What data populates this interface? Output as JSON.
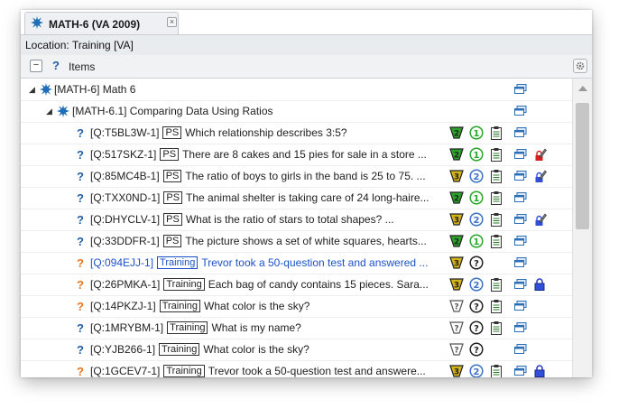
{
  "tab": {
    "title": "MATH-6 (VA 2009)",
    "close": "×"
  },
  "location": "Location: Training [VA]",
  "header": {
    "collapse": "−",
    "label": "Items"
  },
  "tree": {
    "root": {
      "label": "[MATH-6] Math 6"
    },
    "group": {
      "label": "[MATH-6.1] Comparing Data Using Ratios"
    },
    "rows": [
      {
        "id": "[Q:T5BL3W-1]",
        "tag": "PS",
        "text": "Which relationship describes 3:5?",
        "qcolor": "blue",
        "flag": "2",
        "flagcolor": "#2aa52a",
        "circle": "1",
        "circlecolor": "#2aa52a",
        "notes": true,
        "lock": ""
      },
      {
        "id": "[Q:517SKZ-1]",
        "tag": "PS",
        "text": "There are 8 cakes and 15 pies for sale in a store ...",
        "qcolor": "blue",
        "flag": "2",
        "flagcolor": "#2aa52a",
        "circle": "1",
        "circlecolor": "#2aa52a",
        "notes": true,
        "lock": "red"
      },
      {
        "id": "[Q:85MC4B-1]",
        "tag": "PS",
        "text": "The ratio of boys to girls in the band is 25 to 75. ...",
        "qcolor": "blue",
        "flag": "3",
        "flagcolor": "#d4b31a",
        "circle": "2",
        "circlecolor": "#3b73c4",
        "notes": true,
        "lock": "blue"
      },
      {
        "id": "[Q:TXX0ND-1]",
        "tag": "PS",
        "text": "The animal shelter is taking care of 24 long-haire...",
        "qcolor": "blue",
        "flag": "2",
        "flagcolor": "#2aa52a",
        "circle": "1",
        "circlecolor": "#2aa52a",
        "notes": true,
        "lock": ""
      },
      {
        "id": "[Q:DHYCLV-1]",
        "tag": "PS",
        "text": "What is the ratio of stars to total shapes? ...",
        "qcolor": "blue",
        "flag": "3",
        "flagcolor": "#d4b31a",
        "circle": "2",
        "circlecolor": "#3b73c4",
        "notes": true,
        "lock": "blue"
      },
      {
        "id": "[Q:33DDFR-1]",
        "tag": "PS",
        "text": "The picture shows a set of white squares, hearts...",
        "qcolor": "blue",
        "flag": "2",
        "flagcolor": "#2aa52a",
        "circle": "1",
        "circlecolor": "#2aa52a",
        "notes": true,
        "lock": ""
      },
      {
        "id": "[Q:094EJJ-1]",
        "tag": "Training",
        "text": "Trevor took a 50-question test and answered ...",
        "qcolor": "orange",
        "textblue": true,
        "flag": "3",
        "flagcolor": "#d4b31a",
        "circle": "?",
        "circlecolor": "#222",
        "notes": false,
        "lock": ""
      },
      {
        "id": "[Q:26PMKA-1]",
        "tag": "Training",
        "text": "Each bag of candy contains 15 pieces. Sara...",
        "qcolor": "orange",
        "flag": "3",
        "flagcolor": "#d4b31a",
        "circle": "2",
        "circlecolor": "#3b73c4",
        "notes": true,
        "lock": "padlock"
      },
      {
        "id": "[Q:14PKZJ-1]",
        "tag": "Training",
        "text": "What color is the sky?",
        "qcolor": "orange",
        "flag": "?",
        "flagcolor": "#ffffff",
        "circle": "?",
        "circlecolor": "#222",
        "notes": true,
        "lock": ""
      },
      {
        "id": "[Q:1MRYBM-1]",
        "tag": "Training",
        "text": "What is my name?",
        "qcolor": "blue",
        "flag": "?",
        "flagcolor": "#ffffff",
        "circle": "?",
        "circlecolor": "#222",
        "notes": true,
        "lock": ""
      },
      {
        "id": "[Q:YJB266-1]",
        "tag": "Training",
        "text": "What color is the sky?",
        "qcolor": "blue",
        "flag": "?",
        "flagcolor": "#ffffff",
        "circle": "?",
        "circlecolor": "#222",
        "notes": false,
        "lock": ""
      },
      {
        "id": "[Q:1GCEV7-1]",
        "tag": "Training",
        "text": "Trevor took a 50-question test and answere...",
        "qcolor": "orange",
        "flag": "3",
        "flagcolor": "#d4b31a",
        "circle": "2",
        "circlecolor": "#3b73c4",
        "notes": true,
        "lock": "padlock"
      }
    ]
  }
}
